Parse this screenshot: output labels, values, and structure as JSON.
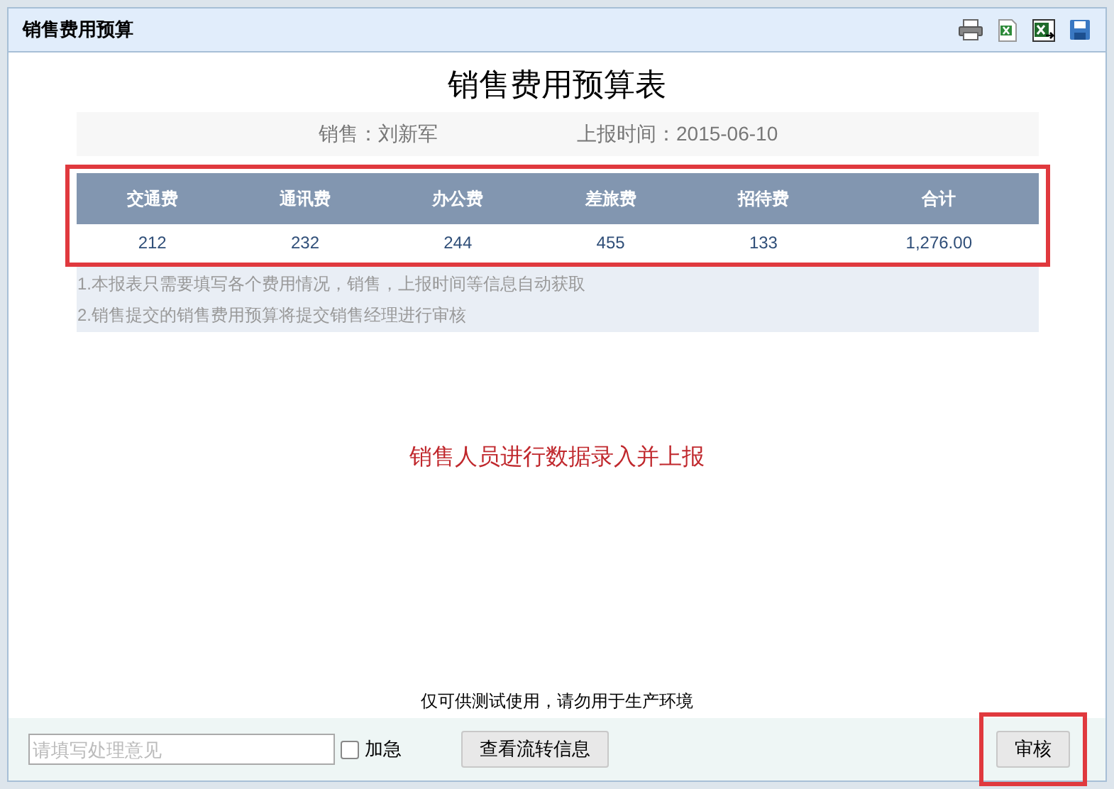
{
  "window": {
    "title": "销售费用预算"
  },
  "toolbar": [
    {
      "kind": "print"
    },
    {
      "kind": "excel"
    },
    {
      "kind": "excel-export"
    },
    {
      "kind": "save"
    }
  ],
  "report": {
    "title": "销售费用预算表",
    "salesperson": "销售：刘新军",
    "report_time": "上报时间：2015-06-10",
    "table": {
      "columns": [
        "交通费",
        "通讯费",
        "办公费",
        "差旅费",
        "招待费",
        "合计"
      ],
      "rows": [
        [
          "212",
          "232",
          "244",
          "455",
          "133",
          "1,276.00"
        ]
      ]
    },
    "notes": [
      "1.本报表只需要填写各个费用情况，销售，上报时间等信息自动获取",
      "2.销售提交的销售费用预算将提交销售经理进行审核"
    ]
  },
  "annotation": "销售人员进行数据录入并上报",
  "disclaimer": "仅可供测试使用，请勿用于生产环境",
  "footer": {
    "opinion": {
      "placeholder": "请填写处理意见"
    },
    "urgent": {
      "label": "加急",
      "checked": false
    },
    "flow_button": "查看流转信息",
    "approve_button": "审核"
  }
}
